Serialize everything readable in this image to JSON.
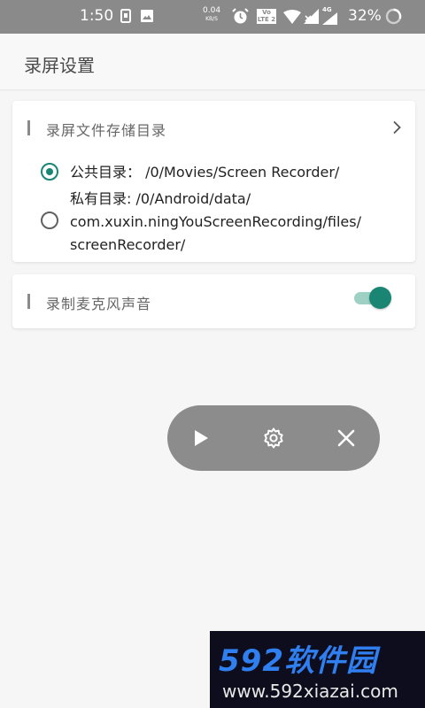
{
  "status_bar": {
    "time": "1:50",
    "net_speed_value": "0.04",
    "net_speed_unit": "KB/S",
    "volte_badge": "Vo LTE 2",
    "network_type": "4G",
    "battery": "32%"
  },
  "app_bar": {
    "title": "录屏设置"
  },
  "storage": {
    "title": "录屏文件存储目录",
    "options": [
      {
        "lines": [
          "公共目录：  /0/Movies/Screen Recorder/"
        ],
        "selected": true
      },
      {
        "lines": [
          "私有目录: /0/Android/data/",
          "com.xuxin.ningYouScreenRecording/files/",
          "screenRecorder/"
        ],
        "selected": false
      }
    ]
  },
  "mic": {
    "title": "录制麦克风声音",
    "enabled": true
  },
  "float_controls": {
    "buttons": [
      "play-icon",
      "settings-gear-icon",
      "close-icon"
    ]
  },
  "watermark": {
    "logo": "592软件园",
    "url": "www.592xiazai.com"
  },
  "colors": {
    "accent": "#1b8574",
    "status_bar": "#8a8a8a",
    "float_bar": "#8c8c8c"
  }
}
